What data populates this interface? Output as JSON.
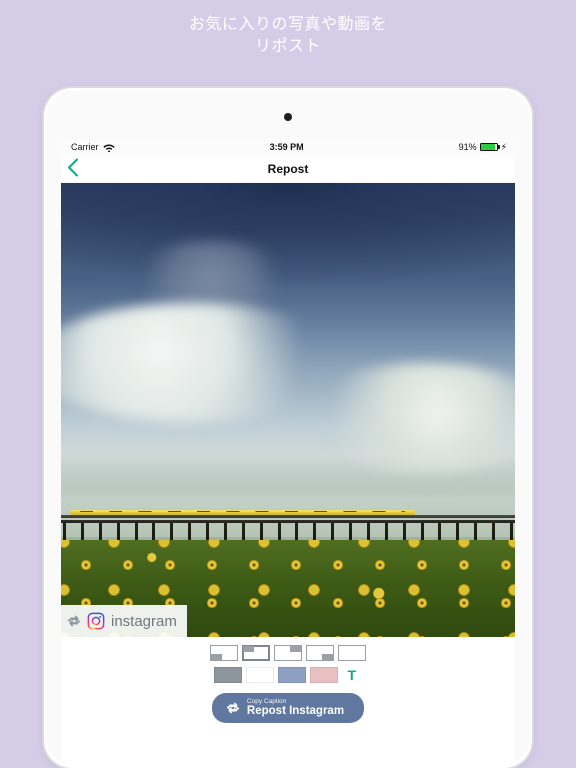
{
  "promo": {
    "line1": "お気に入りの写真や動画を",
    "line2": "リポスト"
  },
  "status": {
    "carrier": "Carrier",
    "time": "3:59 PM",
    "battery_text": "91%"
  },
  "nav": {
    "title": "Repost"
  },
  "badge": {
    "username": "instagram"
  },
  "position_cells": [
    {
      "corner": "bl"
    },
    {
      "corner": "tl",
      "selected": true
    },
    {
      "corner": "tr"
    },
    {
      "corner": "br"
    },
    {
      "corner": "none"
    }
  ],
  "color_swatches": [
    "#8e969d",
    "#ffffff",
    "#8ea0c2",
    "#e9c0c0"
  ],
  "text_toggle_label": "T",
  "cta": {
    "small": "Copy Caption",
    "big": "Repost Instagram"
  }
}
